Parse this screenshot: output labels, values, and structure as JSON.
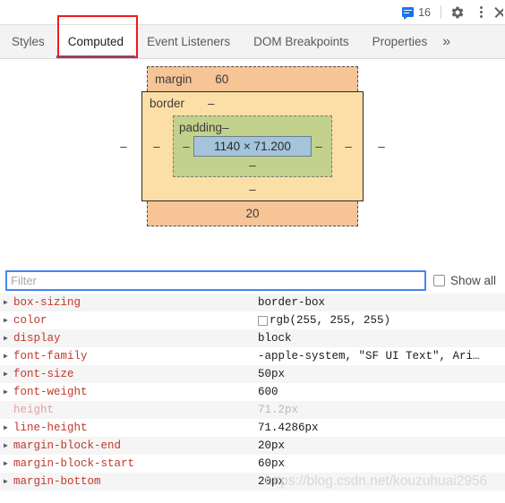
{
  "toolbar": {
    "message_icon": "console-message-icon",
    "message_count": "16",
    "gear_icon": "gear-icon",
    "more_icon": "kebab-menu-icon",
    "close_icon": "close-icon",
    "accent_color": "#1a73e8"
  },
  "tabs": {
    "items": [
      {
        "label": "Styles",
        "active": false
      },
      {
        "label": "Computed",
        "active": true
      },
      {
        "label": "Event Listeners",
        "active": false
      },
      {
        "label": "DOM Breakpoints",
        "active": false
      },
      {
        "label": "Properties",
        "active": false
      }
    ],
    "overflow_label": "»",
    "active_underline_color": "#1a73e8",
    "annotation_color": "#ef1b1b"
  },
  "box_model": {
    "margin_label": "margin",
    "margin_top": "60",
    "margin_bottom": "20",
    "margin_left": "–",
    "margin_right": "–",
    "border_label": "border",
    "border_top": "–",
    "border_bottom": "–",
    "border_left": "–",
    "border_right": "–",
    "padding_label": "padding",
    "padding_top": "–",
    "padding_bottom": "–",
    "padding_left": "–",
    "padding_right": "–",
    "content_size": "1140 × 71.200",
    "colors": {
      "margin": "#f7c496",
      "border": "#fcdfa6",
      "padding": "#c2d18b",
      "content": "#a3c4da"
    }
  },
  "filter": {
    "placeholder": "Filter",
    "value": "",
    "show_all_label": "Show all",
    "show_all_checked": false
  },
  "properties": [
    {
      "name": "box-sizing",
      "value": "border-box",
      "expandable": true,
      "muted": false,
      "swatch": null
    },
    {
      "name": "color",
      "value": "rgb(255, 255, 255)",
      "expandable": true,
      "muted": false,
      "swatch": "#ffffff"
    },
    {
      "name": "display",
      "value": "block",
      "expandable": true,
      "muted": false,
      "swatch": null
    },
    {
      "name": "font-family",
      "value": "-apple-system, \"SF UI Text\", Ari…",
      "expandable": true,
      "muted": false,
      "swatch": null
    },
    {
      "name": "font-size",
      "value": "50px",
      "expandable": true,
      "muted": false,
      "swatch": null
    },
    {
      "name": "font-weight",
      "value": "600",
      "expandable": true,
      "muted": false,
      "swatch": null
    },
    {
      "name": "height",
      "value": "71.2px",
      "expandable": false,
      "muted": true,
      "swatch": null
    },
    {
      "name": "line-height",
      "value": "71.4286px",
      "expandable": true,
      "muted": false,
      "swatch": null
    },
    {
      "name": "margin-block-end",
      "value": "20px",
      "expandable": true,
      "muted": false,
      "swatch": null
    },
    {
      "name": "margin-block-start",
      "value": "60px",
      "expandable": true,
      "muted": false,
      "swatch": null
    },
    {
      "name": "margin-bottom",
      "value": "20px",
      "expandable": true,
      "muted": false,
      "swatch": null
    }
  ],
  "watermark": "https://blog.csdn.net/kouzuhuai2956"
}
